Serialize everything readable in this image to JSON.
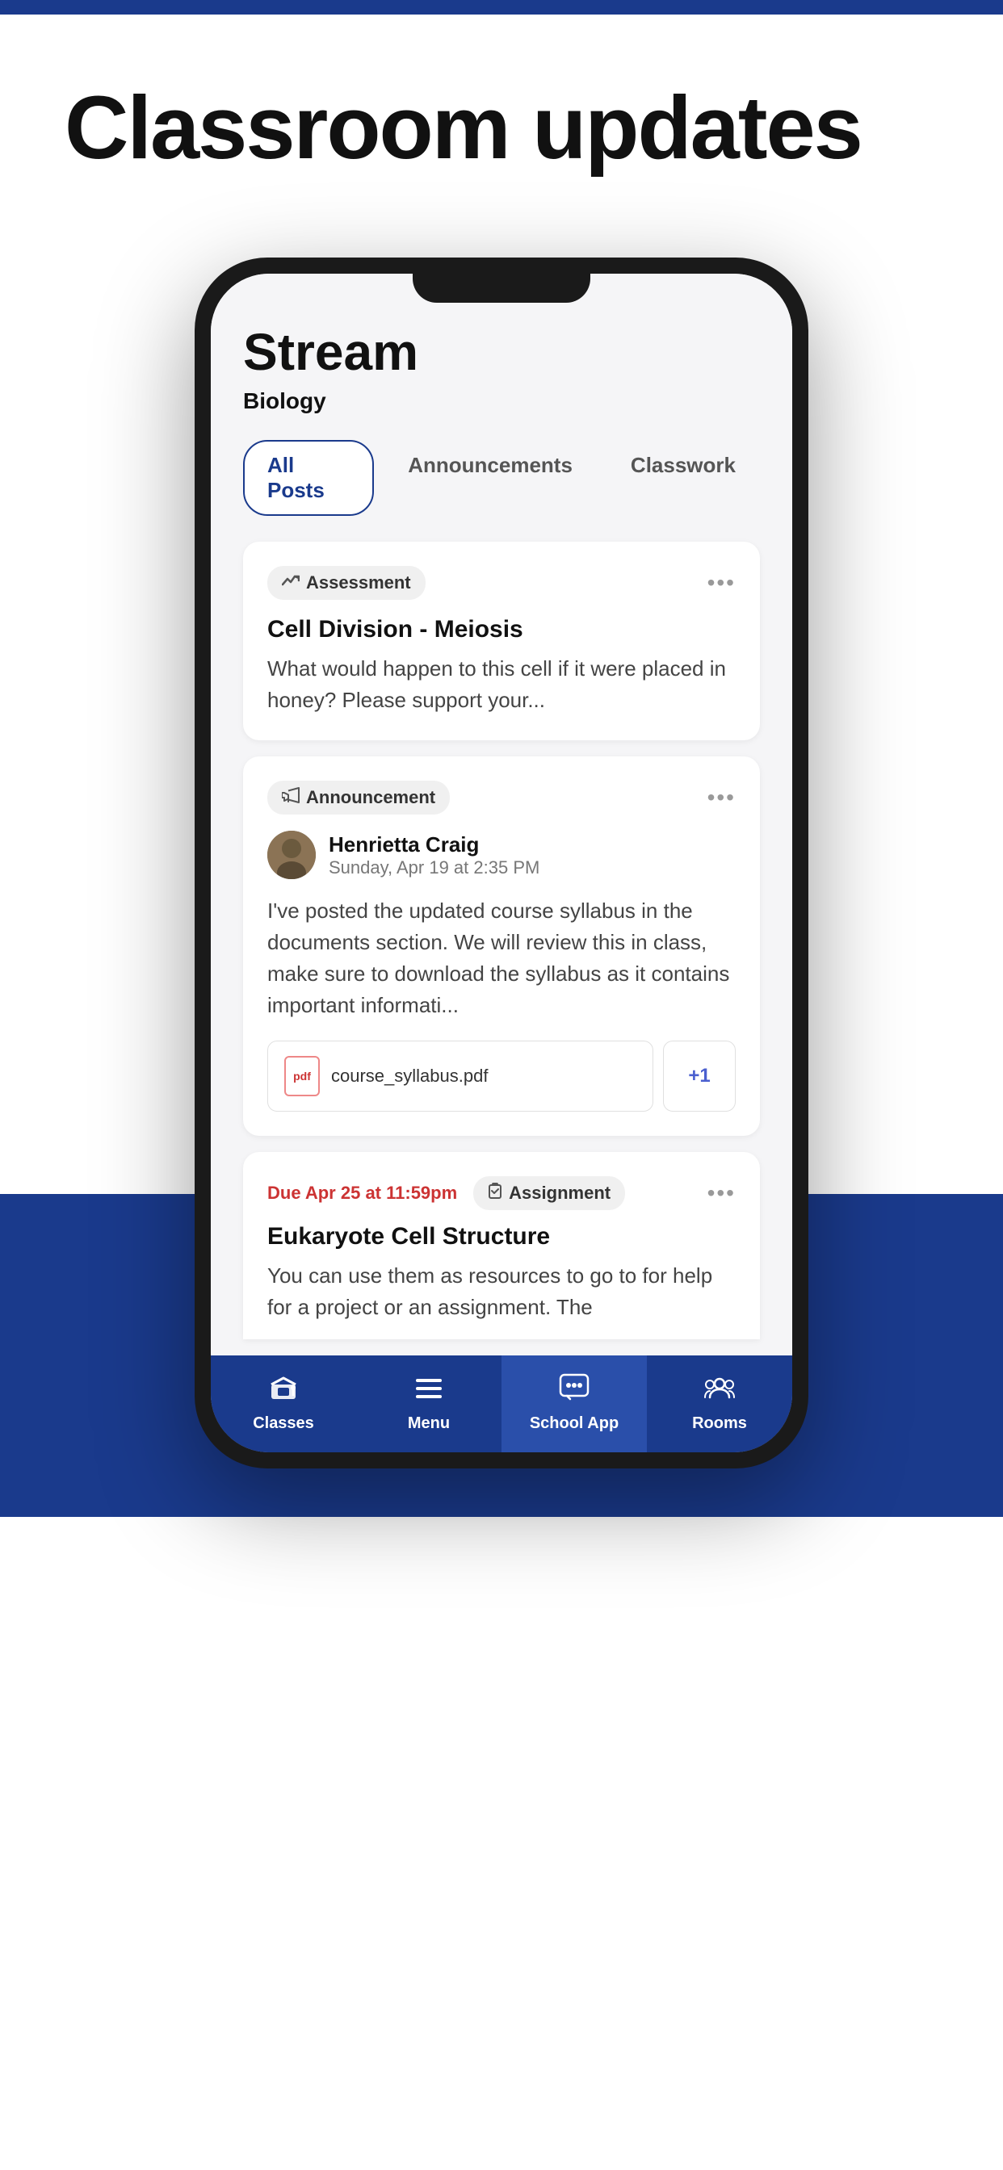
{
  "topBar": {
    "color": "#1a3a8c"
  },
  "hero": {
    "title": "Classroom updates"
  },
  "phone": {
    "stream": {
      "title": "Stream",
      "subtitle": "Biology"
    },
    "tabs": [
      {
        "label": "All Posts",
        "active": true
      },
      {
        "label": "Announcements",
        "active": false
      },
      {
        "label": "Classwork",
        "active": false
      }
    ],
    "cards": [
      {
        "type": "assessment",
        "badge": "Assessment",
        "badge_icon": "📈",
        "title": "Cell Division - Meiosis",
        "body": "What would happen to this cell if it were placed in honey? Please support your..."
      },
      {
        "type": "announcement",
        "badge": "Announcement",
        "badge_icon": "📢",
        "author_name": "Henrietta Craig",
        "author_date": "Sunday, Apr 19 at 2:35 PM",
        "body": "I've posted the updated course syllabus in the documents section. We will review this in class, make sure to download the syllabus as it contains important informati...",
        "attachment": "course_syllabus.pdf",
        "plus_more": "+1"
      },
      {
        "type": "assignment",
        "due_label": "Due Apr 25 at 11:59pm",
        "badge": "Assignment",
        "badge_icon": "✅",
        "title": "Eukaryote Cell Structure",
        "body": "You can use them as resources to go to for help for a project or an assignment. The"
      }
    ],
    "nav": [
      {
        "label": "Classes",
        "icon": "🎓",
        "active": false
      },
      {
        "label": "Menu",
        "icon": "☰",
        "active": false
      },
      {
        "label": "School App",
        "icon": "💬",
        "active": true
      },
      {
        "label": "Rooms",
        "icon": "👥",
        "active": false
      }
    ]
  }
}
